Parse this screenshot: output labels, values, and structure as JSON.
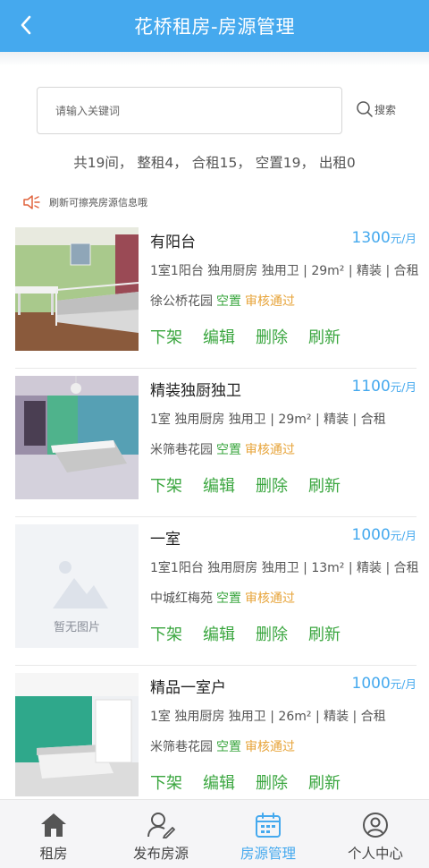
{
  "header": {
    "title": "花桥租房-房源管理"
  },
  "search": {
    "placeholder": "请输入关键词",
    "button_label": "搜索"
  },
  "stats": {
    "text": "共19间， 整租4， 合租15， 空置19， 出租0"
  },
  "notice": {
    "text": "刷新可擦亮房源信息哦"
  },
  "listings": [
    {
      "name": "有阳台",
      "price": "1300",
      "unit": "元/月",
      "desc": "1室1阳台 独用厨房 独用卫 | 29m² | 精装 | 合租",
      "location": "徐公桥花园",
      "status_vacant": "空置",
      "status_audit": "审核通过",
      "image": "photo-bedroom-green-wall"
    },
    {
      "name": "精装独厨独卫",
      "price": "1100",
      "unit": "元/月",
      "desc": "1室 独用厨房 独用卫 | 29m² | 精装 | 合租",
      "location": "米筛巷花园",
      "status_vacant": "空置",
      "status_audit": "审核通过",
      "image": "photo-bedroom-chandelier"
    },
    {
      "name": "一室",
      "price": "1000",
      "unit": "元/月",
      "desc": "1室1阳台 独用厨房 独用卫 | 13m² | 精装 | 合租",
      "location": "中城红梅苑",
      "status_vacant": "空置",
      "status_audit": "审核通过",
      "image": "no-image-placeholder",
      "placeholder_text": "暂无图片"
    },
    {
      "name": "精品一室户",
      "price": "1000",
      "unit": "元/月",
      "desc": "1室 独用厨房 独用卫 | 26m² | 精装 | 合租",
      "location": "米筛巷花园",
      "status_vacant": "空置",
      "status_audit": "审核通过",
      "image": "photo-bedroom-green-panels"
    }
  ],
  "actions": {
    "delist": "下架",
    "edit": "编辑",
    "delete": "删除",
    "refresh": "刷新"
  },
  "tabbar": [
    {
      "label": "租房",
      "icon": "home-icon",
      "active": false
    },
    {
      "label": "发布房源",
      "icon": "publish-user-icon",
      "active": false
    },
    {
      "label": "房源管理",
      "icon": "calendar-icon",
      "active": true
    },
    {
      "label": "个人中心",
      "icon": "profile-icon",
      "active": false
    }
  ],
  "colors": {
    "primary": "#45a9ee",
    "green": "#3aa63f",
    "orange": "#e7a43a"
  }
}
